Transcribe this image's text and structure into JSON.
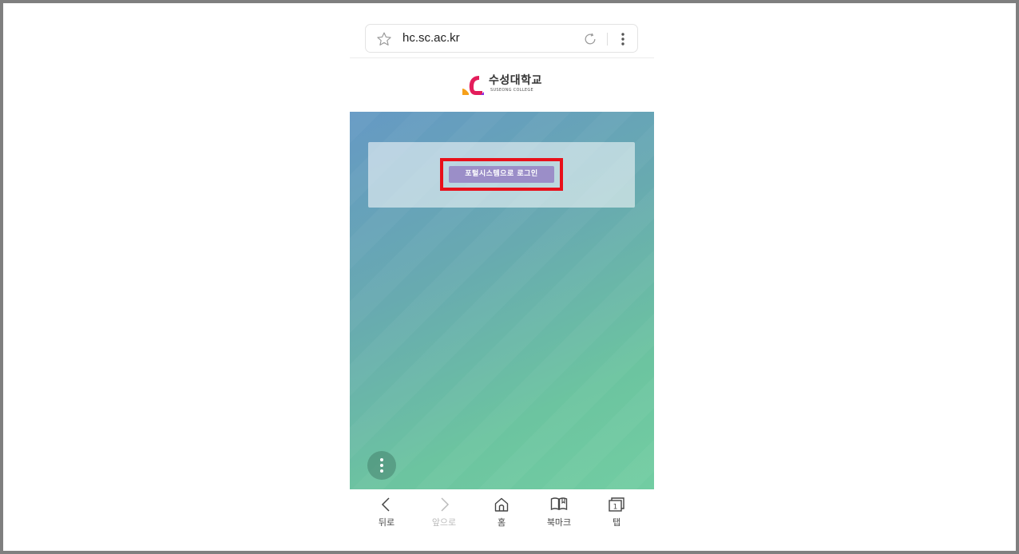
{
  "browser": {
    "url": "hc.sc.ac.kr",
    "star_icon": "star-outline-icon",
    "reload_icon": "reload-icon",
    "menu_icon": "kebab-menu-icon"
  },
  "site": {
    "logo_ko": "수성대학교",
    "logo_en": "SUSEONG COLLEGE",
    "login_button": "포털시스템으로 로그인",
    "highlight_color": "#e8101a",
    "button_color": "#9b8ec8"
  },
  "bottom_nav": {
    "items": [
      {
        "label": "뒤로",
        "icon": "chevron-left-icon"
      },
      {
        "label": "앞으로",
        "icon": "chevron-right-icon",
        "disabled": true
      },
      {
        "label": "홈",
        "icon": "home-icon"
      },
      {
        "label": "북마크",
        "icon": "bookmark-book-icon"
      },
      {
        "label": "탭",
        "icon": "tabs-icon",
        "count": "1"
      }
    ]
  }
}
